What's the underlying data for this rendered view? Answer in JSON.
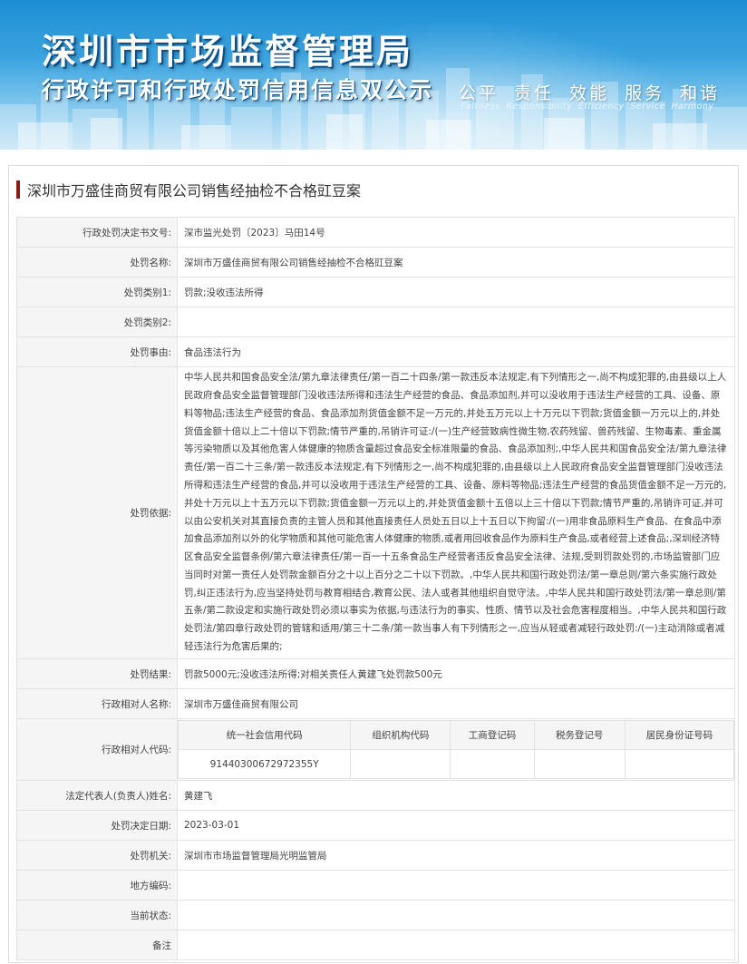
{
  "banner": {
    "title": "深圳市市场监督管理局",
    "subtitle": "行政许可和行政处罚信用信息双公示",
    "slogan": "公平 责任 效能 服务 和谐",
    "slogan_en": "Fairness Responsibility Efficiency Service Harmony"
  },
  "case_title": "深圳市万盛佳商贸有限公司销售经抽检不合格豇豆案",
  "rows": {
    "doc_no": {
      "label": "行政处罚决定书文号:",
      "value": "深市监光处罚〔2023〕马田14号"
    },
    "name": {
      "label": "处罚名称:",
      "value": "深圳市万盛佳商贸有限公司销售经抽检不合格豇豆案"
    },
    "type1": {
      "label": "处罚类别1:",
      "value": "罚款;没收违法所得"
    },
    "type2": {
      "label": "处罚类别2:",
      "value": ""
    },
    "reason": {
      "label": "处罚事由:",
      "value": "食品违法行为"
    },
    "basis": {
      "label": "处罚依据:",
      "value": "中华人民共和国食品安全法/第九章法律责任/第一百二十四条/第一款违反本法规定,有下列情形之一,尚不构成犯罪的,由县级以上人民政府食品安全监督管理部门没收违法所得和违法生产经营的食品、食品添加剂,并可以没收用于违法生产经营的工具、设备、原料等物品;违法生产经营的食品、食品添加剂货值金额不足一万元的,并处五万元以上十万元以下罚款;货值金额一万元以上的,并处货值金额十倍以上二十倍以下罚款;情节严重的,吊销许可证:/(一)生产经营致病性微生物,农药残留、兽药残留、生物毒素、重金属等污染物质以及其他危害人体健康的物质含量超过食品安全标准限量的食品、食品添加剂;,中华人民共和国食品安全法/第九章法律责任/第一百二十三条/第一款违反本法规定,有下列情形之一,尚不构成犯罪的,由县级以上人民政府食品安全监督管理部门没收违法所得和违法生产经营的食品,并可以没收用于违法生产经营的工具、设备、原料等物品;违法生产经营的食品货值金额不足一万元的,并处十万元以上十五万元以下罚款;货值金额一万元以上的,并处货值金额十五倍以上三十倍以下罚款;情节严重的,吊销许可证,并可以由公安机关对其直接负责的主管人员和其他直接责任人员处五日以上十五日以下拘留:/(一)用非食品原料生产食品、在食品中添加食品添加剂以外的化学物质和其他可能危害人体健康的物质,或者用回收食品作为原料生产食品,或者经营上述食品;,深圳经济特区食品安全监督条例/第六章法律责任/第一百一十五条食品生产经营者违反食品安全法律、法规,受到罚款处罚的,市场监管部门应当同时对第一责任人处罚款金额百分之十以上百分之二十以下罚款。,中华人民共和国行政处罚法/第一章总则/第六条实施行政处罚,纠正违法行为,应当坚持处罚与教育相结合,教育公民、法人或者其他组织自觉守法。,中华人民共和国行政处罚法/第一章总则/第五条/第二款设定和实施行政处罚必须以事实为依据,与违法行为的事实、性质、情节以及社会危害程度相当。,中华人民共和国行政处罚法/第四章行政处罚的管辖和适用/第三十二条/第一款当事人有下列情形之一,应当从轻或者减轻行政处罚:/(一)主动消除或者减轻违法行为危害后果的;"
    },
    "result": {
      "label": "处罚结果:",
      "value": "罚款5000元;没收违法所得;对相关责任人黄建飞处罚款500元"
    },
    "party": {
      "label": "行政相对人名称:",
      "value": "深圳市万盛佳商贸有限公司"
    },
    "party_code": {
      "label": "行政相对人代码:",
      "headers": [
        "统一社会信用代码",
        "组织机构代码",
        "工商登记码",
        "税务登记号",
        "居民身份证号码"
      ],
      "values": [
        "91440300672972355Y",
        "",
        "",
        "",
        ""
      ]
    },
    "legal_rep": {
      "label": "法定代表人(负责人)姓名:",
      "value": "黄建飞"
    },
    "date": {
      "label": "处罚决定日期:",
      "value": "2023-03-01"
    },
    "authority": {
      "label": "处罚机关:",
      "value": "深圳市市场监督管理局光明监管局"
    },
    "local_code": {
      "label": "地方编码:",
      "value": ""
    },
    "status": {
      "label": "当前状态:",
      "value": ""
    },
    "remark": {
      "label": "备注",
      "value": ""
    }
  }
}
